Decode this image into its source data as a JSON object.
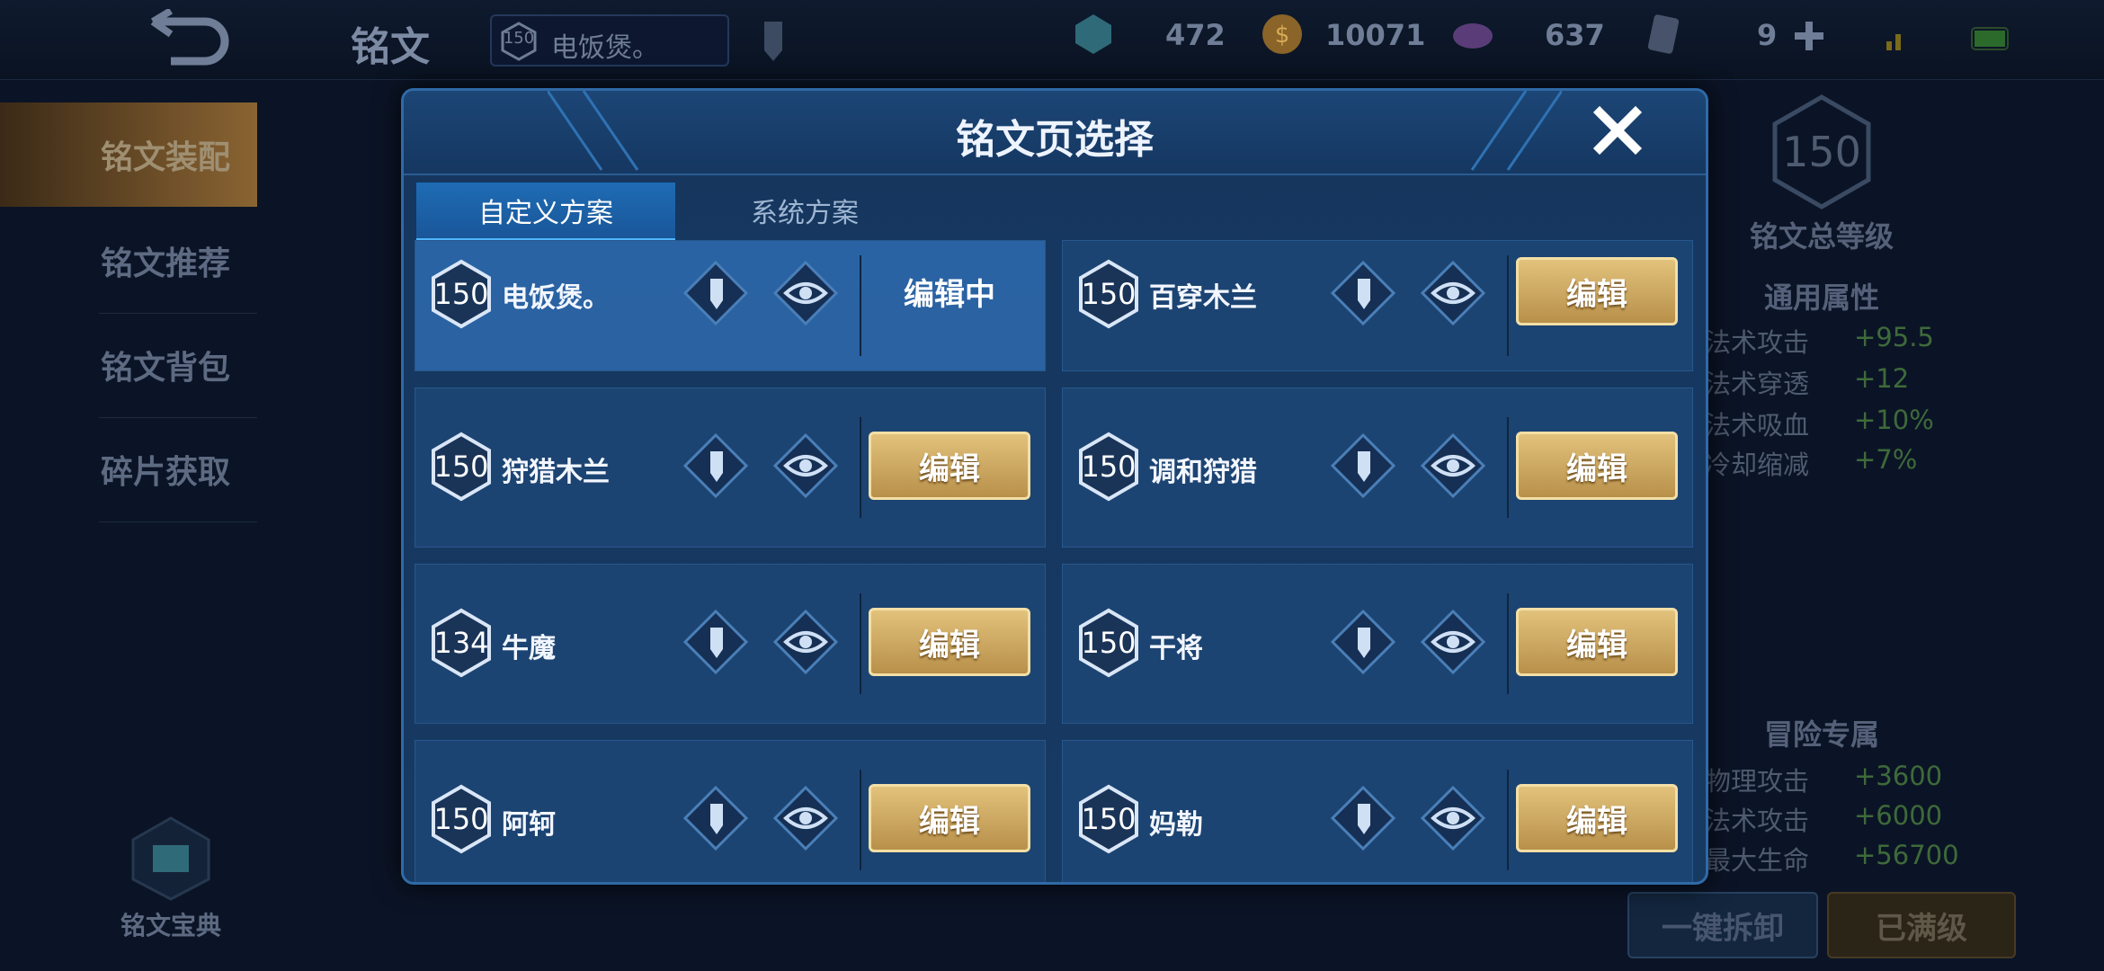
{
  "topbar": {
    "title": "铭文",
    "current_page": {
      "level": "150",
      "name": "电饭煲。"
    },
    "resources": [
      {
        "icon": "gem-icon",
        "value": "472"
      },
      {
        "icon": "gold-coin-icon",
        "value": "10071"
      },
      {
        "icon": "crystal-icon",
        "value": "637"
      },
      {
        "icon": "card-icon",
        "value": "9"
      }
    ]
  },
  "sidebar": {
    "items": [
      {
        "label": "铭文装配"
      },
      {
        "label": "铭文推荐"
      },
      {
        "label": "铭文背包"
      },
      {
        "label": "碎片获取"
      }
    ],
    "codex_label": "铭文宝典"
  },
  "right_panel": {
    "total_level": "150",
    "total_level_label": "铭文总等级",
    "general_title": "通用属性",
    "general": [
      {
        "label": "法术攻击",
        "value": "+95.5"
      },
      {
        "label": "法术穿透",
        "value": "+12"
      },
      {
        "label": "法术吸血",
        "value": "+10%"
      },
      {
        "label": "冷却缩减",
        "value": "+7%"
      }
    ],
    "adventure_title": "冒险专属",
    "adventure": [
      {
        "label": "物理攻击",
        "value": "+3600"
      },
      {
        "label": "法术攻击",
        "value": "+6000"
      },
      {
        "label": "最大生命",
        "value": "+56700"
      }
    ],
    "unequip_label": "一键拆卸",
    "maxed_label": "已满级"
  },
  "modal": {
    "title": "铭文页选择",
    "tabs": [
      {
        "label": "自定义方案"
      },
      {
        "label": "系统方案"
      }
    ],
    "editing_label": "编辑中",
    "edit_label": "编辑",
    "pages": [
      {
        "level": "150",
        "name": "电饭煲。"
      },
      {
        "level": "150",
        "name": "百穿木兰"
      },
      {
        "level": "150",
        "name": "狩猎木兰"
      },
      {
        "level": "150",
        "name": "调和狩猎"
      },
      {
        "level": "134",
        "name": "牛魔"
      },
      {
        "level": "150",
        "name": "干将"
      },
      {
        "level": "150",
        "name": "阿轲"
      },
      {
        "level": "150",
        "name": "妈勒"
      }
    ]
  },
  "colors": {
    "accent": "#d9b46a",
    "panel": "#1c4472",
    "selected": "#2a63a3"
  }
}
